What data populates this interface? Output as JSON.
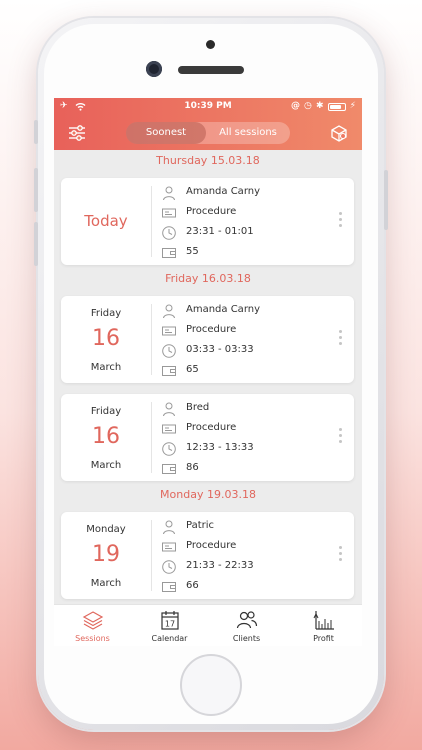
{
  "status": {
    "time": "10:39 PM"
  },
  "header": {
    "segments": [
      "Soonest",
      "All sessions"
    ],
    "active_segment": 0,
    "filter_icon": "sliders-icon",
    "box_icon": "box-icon"
  },
  "sections": [
    {
      "date_label": "Thursday 15.03.18",
      "sessions": [
        {
          "today_label": "Today",
          "client": "Amanda Carny",
          "service": "Procedure",
          "time": "23:31 - 01:01",
          "amount": "55"
        }
      ]
    },
    {
      "date_label": "Friday 16.03.18",
      "sessions": [
        {
          "dow": "Friday",
          "day": "16",
          "month": "March",
          "client": "Amanda Carny",
          "service": "Procedure",
          "time": "03:33 - 03:33",
          "amount": "65"
        },
        {
          "dow": "Friday",
          "day": "16",
          "month": "March",
          "client": "Bred",
          "service": "Procedure",
          "time": "12:33 - 13:33",
          "amount": "86"
        }
      ]
    },
    {
      "date_label": "Monday 19.03.18",
      "sessions": [
        {
          "dow": "Monday",
          "day": "19",
          "month": "March",
          "client": "Patric",
          "service": "Procedure",
          "time": "21:33 - 22:33",
          "amount": "66"
        }
      ]
    }
  ],
  "tabbar": {
    "items": [
      {
        "label": "Sessions",
        "icon": "layers-icon",
        "active": true
      },
      {
        "label": "Calendar",
        "icon": "calendar-icon",
        "badge": "17"
      },
      {
        "label": "Clients",
        "icon": "users-icon"
      },
      {
        "label": "Profit",
        "icon": "chart-icon"
      }
    ]
  },
  "colors": {
    "accent": "#e0675d",
    "header_start": "#e8615a",
    "header_end": "#f08a6a"
  }
}
